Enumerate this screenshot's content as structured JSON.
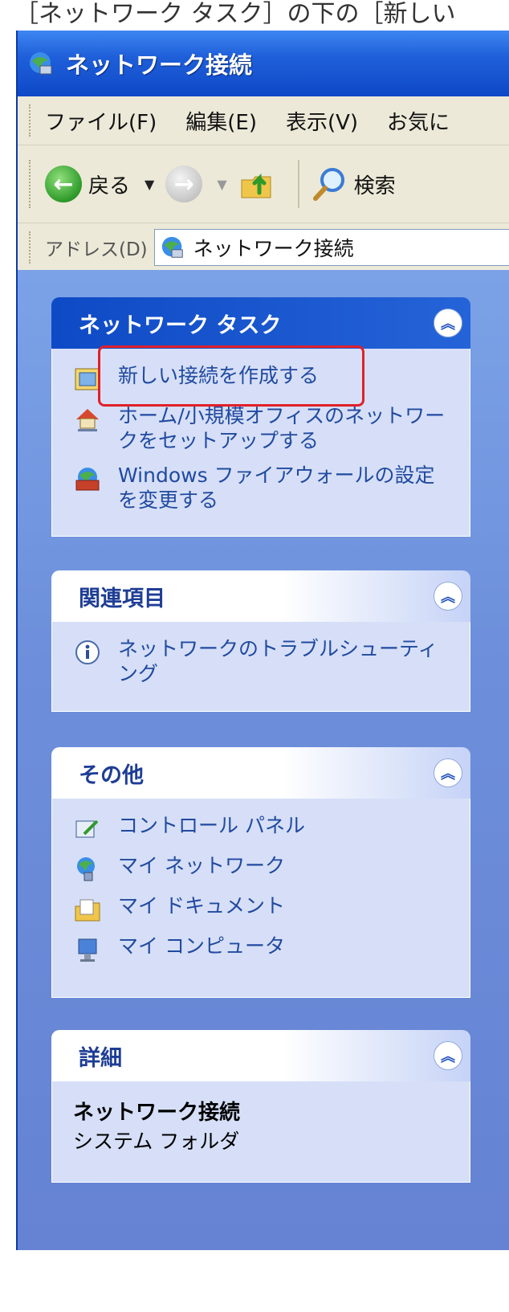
{
  "caption": "［ネットワーク タスク］の下の［新しい",
  "window": {
    "title": "ネットワーク接続"
  },
  "menu": [
    "ファイル(F)",
    "編集(E)",
    "表示(V)",
    "お気に"
  ],
  "toolbar": {
    "back_label": "戻る",
    "search_label": "検索"
  },
  "address": {
    "label": "アドレス(D)",
    "value": "ネットワーク接続"
  },
  "panels": {
    "network_tasks": {
      "title": "ネットワーク タスク",
      "items": [
        "新しい接続を作成する",
        "ホーム/小規模オフィスのネットワークをセットアップする",
        "Windows ファイアウォールの設定を変更する"
      ]
    },
    "related": {
      "title": "関連項目",
      "items": [
        "ネットワークのトラブルシューティング"
      ]
    },
    "other": {
      "title": "その他",
      "items": [
        "コントロール パネル",
        "マイ ネットワーク",
        "マイ ドキュメント",
        "マイ コンピュータ"
      ]
    },
    "details": {
      "title": "詳細",
      "name": "ネットワーク接続",
      "type": "システム フォルダ"
    }
  }
}
